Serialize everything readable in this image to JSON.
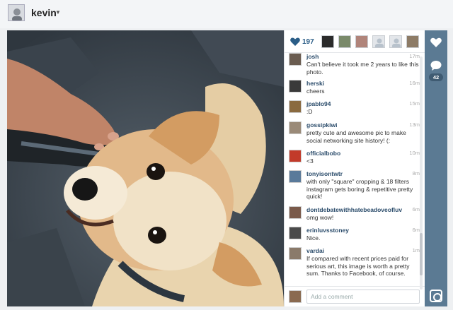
{
  "header": {
    "username": "kevin"
  },
  "photo": {
    "alt": ""
  },
  "likes": {
    "count": "197"
  },
  "comments_count": "42",
  "comments": [
    {
      "user": "josh",
      "time": "17m",
      "text": "Can't believe it took me 2 years to like this photo."
    },
    {
      "user": "herski",
      "time": "16m",
      "text": "cheers"
    },
    {
      "user": "jpablo94",
      "time": "15m",
      "text": ":D"
    },
    {
      "user": "gossipkiwi",
      "time": "13m",
      "text": "pretty cute and awesome pic to make social networking site history! (:"
    },
    {
      "user": "officialbobo",
      "time": "10m",
      "text": "<3"
    },
    {
      "user": "tonyisontwtr",
      "time": "8m",
      "text": "with only \"square\" cropping & 18 filters instagram gets boring & repetitive pretty quick!"
    },
    {
      "user": "dontdebatewithhatebeadoveofluv",
      "time": "6m",
      "text": "omg wow!"
    },
    {
      "user": "erinluvsstoney",
      "time": "6m",
      "text": "Nice."
    },
    {
      "user": "vardai",
      "time": "1m",
      "text": "If compared with recent prices paid for serious art, this image is worth a pretty sum. Thanks to Facebook, of course."
    }
  ],
  "add_comment": {
    "placeholder": "Add a comment"
  },
  "colors": {
    "accent": "#2a5d87",
    "action_bar": "#5b7a93"
  }
}
